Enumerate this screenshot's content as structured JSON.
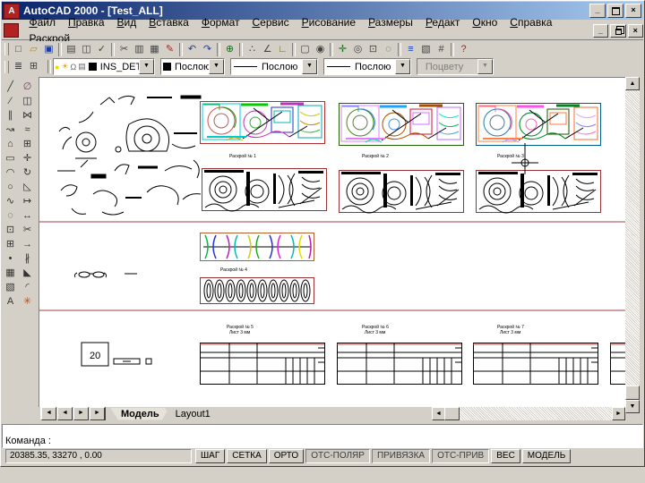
{
  "window": {
    "title": "AutoCAD 2000 - [Test_ALL]",
    "app_icon_letter": "A",
    "minimize_glyph": "_",
    "close_glyph": "×"
  },
  "menu": {
    "items": [
      "Файл",
      "Правка",
      "Вид",
      "Вставка",
      "Формат",
      "Сервис",
      "Рисование",
      "Размеры",
      "Редакт",
      "Окно",
      "Справка",
      "Раскрой"
    ]
  },
  "toolbars": {
    "standard": [
      {
        "n": "new-file-icon",
        "g": "□",
        "c": "#444444"
      },
      {
        "n": "open-folder-icon",
        "g": "▱",
        "c": "#b8860b"
      },
      {
        "n": "save-icon",
        "g": "▣",
        "c": "#1a3ca8"
      },
      {
        "sep": true
      },
      {
        "n": "print-icon",
        "g": "▤",
        "c": "#444444"
      },
      {
        "n": "print-preview-icon",
        "g": "◫",
        "c": "#444444"
      },
      {
        "n": "spelling-icon",
        "g": "✓",
        "c": "#444444"
      },
      {
        "sep": true
      },
      {
        "n": "cut-icon",
        "g": "✂",
        "c": "#444444"
      },
      {
        "n": "copy-icon",
        "g": "▥",
        "c": "#444444"
      },
      {
        "n": "paste-icon",
        "g": "▦",
        "c": "#444444"
      },
      {
        "n": "match-properties-icon",
        "g": "✎",
        "c": "#b02020"
      },
      {
        "sep": true
      },
      {
        "n": "undo-icon",
        "g": "↶",
        "c": "#1a3ca8"
      },
      {
        "n": "redo-icon",
        "g": "↷",
        "c": "#1a3ca8"
      },
      {
        "sep": true
      },
      {
        "n": "insert-hyperlink-icon",
        "g": "⊕",
        "c": "#1a6a1a"
      },
      {
        "sep": true
      },
      {
        "n": "tracking-icon",
        "g": "∴",
        "c": "#444444"
      },
      {
        "n": "snap-from-icon",
        "g": "∠",
        "c": "#444444"
      },
      {
        "n": "ucs-icon",
        "g": "∟",
        "c": "#7a6a00"
      },
      {
        "sep": true
      },
      {
        "n": "named-views-icon",
        "g": "▢",
        "c": "#444444"
      },
      {
        "n": "3d-orbit-icon",
        "g": "◉",
        "c": "#444444"
      },
      {
        "sep": true
      },
      {
        "n": "pan-realtime-icon",
        "g": "✛",
        "c": "#1a6a1a"
      },
      {
        "n": "zoom-realtime-icon",
        "g": "◎",
        "c": "#444444"
      },
      {
        "n": "zoom-window-icon",
        "g": "⊡",
        "c": "#444444"
      },
      {
        "n": "zoom-previous-icon",
        "g": "◌",
        "c": "#444444"
      },
      {
        "sep": true
      },
      {
        "n": "properties-icon",
        "g": "≡",
        "c": "#1a3ca8"
      },
      {
        "n": "design-center-icon",
        "g": "▧",
        "c": "#444444"
      },
      {
        "n": "dbconnect-icon",
        "g": "#",
        "c": "#444444"
      },
      {
        "sep": true
      },
      {
        "n": "help-icon",
        "g": "?",
        "c": "#b02020"
      }
    ],
    "object_properties": {
      "lead_icons": [
        {
          "n": "make-object-layer-current-icon",
          "g": "≣",
          "c": "#444444"
        },
        {
          "n": "layers-dialog-icon",
          "g": "⊞",
          "c": "#444444"
        }
      ],
      "layer_state_icons": [
        {
          "n": "layer-on-bulb-icon",
          "g": "●",
          "c": "#e8d800"
        },
        {
          "n": "layer-freeze-icon",
          "g": "☀",
          "c": "#d8a800"
        },
        {
          "n": "layer-lock-icon",
          "g": "Ω",
          "c": "#666666"
        },
        {
          "n": "layer-plot-icon",
          "g": "▤",
          "c": "#666666"
        }
      ],
      "layer_value": "INS_DETAL",
      "color_value": "Послою",
      "linetype_value": "Послою",
      "lineweight_value": "Послою",
      "plotstyle_value": "Поцвету",
      "dropdown_arrow": "▼"
    },
    "draw": [
      {
        "n": "line-icon",
        "g": "╱",
        "c": "#333333"
      },
      {
        "n": "construction-line-icon",
        "g": "⁄",
        "c": "#333333"
      },
      {
        "n": "multiline-icon",
        "g": "∥",
        "c": "#333333"
      },
      {
        "n": "polyline-icon",
        "g": "↝",
        "c": "#333333"
      },
      {
        "n": "polygon-icon",
        "g": "⌂",
        "c": "#333333"
      },
      {
        "n": "rectangle-icon",
        "g": "▭",
        "c": "#333333"
      },
      {
        "n": "arc-icon",
        "g": "◠",
        "c": "#333333"
      },
      {
        "n": "circle-icon",
        "g": "○",
        "c": "#333333"
      },
      {
        "n": "spline-icon",
        "g": "∿",
        "c": "#333333"
      },
      {
        "n": "ellipse-icon",
        "g": "◌",
        "c": "#333333"
      },
      {
        "n": "insert-block-icon",
        "g": "⊡",
        "c": "#333333"
      },
      {
        "n": "make-block-icon",
        "g": "⊞",
        "c": "#333333"
      },
      {
        "n": "point-icon",
        "g": "•",
        "c": "#333333"
      },
      {
        "n": "hatch-icon",
        "g": "▦",
        "c": "#333333"
      },
      {
        "n": "region-icon",
        "g": "▧",
        "c": "#333333"
      },
      {
        "n": "multiline-text-icon",
        "g": "A",
        "c": "#333333"
      }
    ],
    "modify": [
      {
        "n": "erase-icon",
        "g": "∅",
        "c": "#7a3a6a"
      },
      {
        "n": "copy-object-icon",
        "g": "◫",
        "c": "#333333"
      },
      {
        "n": "mirror-icon",
        "g": "⋈",
        "c": "#333333"
      },
      {
        "n": "offset-icon",
        "g": "≈",
        "c": "#333333"
      },
      {
        "n": "array-icon",
        "g": "⊞",
        "c": "#333333"
      },
      {
        "n": "move-icon",
        "g": "✛",
        "c": "#333333"
      },
      {
        "n": "rotate-icon",
        "g": "↻",
        "c": "#333333"
      },
      {
        "n": "scale-icon",
        "g": "◺",
        "c": "#333333"
      },
      {
        "n": "stretch-icon",
        "g": "↦",
        "c": "#333333"
      },
      {
        "n": "lengthen-icon",
        "g": "↔",
        "c": "#333333"
      },
      {
        "n": "trim-icon",
        "g": "✂",
        "c": "#333333"
      },
      {
        "n": "extend-icon",
        "g": "→",
        "c": "#333333"
      },
      {
        "n": "break-icon",
        "g": "∦",
        "c": "#333333"
      },
      {
        "n": "chamfer-icon",
        "g": "◣",
        "c": "#333333"
      },
      {
        "n": "fillet-icon",
        "g": "◜",
        "c": "#333333"
      },
      {
        "n": "explode-icon",
        "g": "✳",
        "c": "#b05010"
      }
    ]
  },
  "canvas": {
    "captions": {
      "layouts": [
        "Раскрой № 1",
        "Раскрой № 2",
        "Раскрой № 3"
      ],
      "strip": "Раскрой № 4",
      "tables": [
        {
          "line1": "Раскрой № 5",
          "line2": "Лист 3 мм"
        },
        {
          "line1": "Раскрой № 6",
          "line2": "Лист 3 мм"
        },
        {
          "line1": "Раскрой № 7",
          "line2": "Лист 3 мм"
        }
      ]
    },
    "small_part_label": "20"
  },
  "tabs": {
    "nav": [
      "◄",
      "◄",
      "►",
      "►"
    ],
    "model": "Модель",
    "layout1": "Layout1"
  },
  "command": {
    "prompt": "Команда :"
  },
  "status": {
    "coords": "20385.35, 33270 , 0.00",
    "buttons": [
      {
        "label": "ШАГ",
        "pressed": false
      },
      {
        "label": "СЕТКА",
        "pressed": false
      },
      {
        "label": "ОРТО",
        "pressed": false
      },
      {
        "label": "ОТС-ПОЛЯР",
        "pressed": true
      },
      {
        "label": "ПРИВЯЗКА",
        "pressed": true
      },
      {
        "label": "ОТС-ПРИВ",
        "pressed": true
      },
      {
        "label": "ВЕС",
        "pressed": false
      },
      {
        "label": "МОДЕЛЬ",
        "pressed": false
      }
    ]
  },
  "colors": {
    "titlebar_left": "#0a246a",
    "titlebar_right": "#a6caf0",
    "chrome": "#d4d0c8",
    "layout_border": "#b03030",
    "band_line": "#a04040"
  }
}
